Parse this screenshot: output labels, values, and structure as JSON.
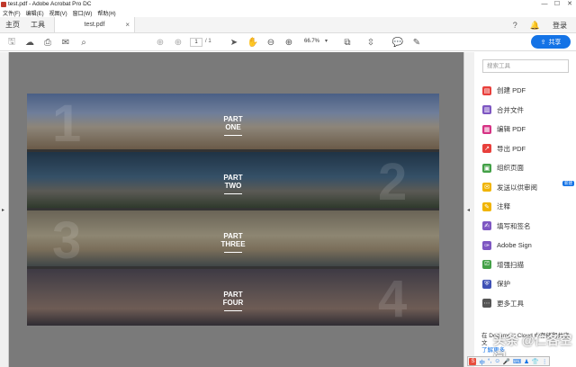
{
  "window": {
    "title": "test.pdf - Adobe Acrobat Pro DC",
    "min": "—",
    "max": "☐",
    "close": "✕"
  },
  "menu": [
    "文件(F)",
    "编辑(E)",
    "视图(V)",
    "窗口(W)",
    "帮助(H)"
  ],
  "tabs": {
    "home": "主页",
    "tools": "工具",
    "doc": "test.pdf"
  },
  "header_right": {
    "login": "登录"
  },
  "toolbar": {
    "page_current": "1",
    "page_total": "/ 1",
    "zoom": "66.7%",
    "share_label": "共享"
  },
  "document": {
    "parts": [
      {
        "label1": "PART",
        "label2": "ONE",
        "number": "1"
      },
      {
        "label1": "PART",
        "label2": "TWO",
        "number": "2"
      },
      {
        "label1": "PART",
        "label2": "THREE",
        "number": "3"
      },
      {
        "label1": "PART",
        "label2": "FOUR",
        "number": "4"
      }
    ]
  },
  "panel": {
    "search_placeholder": "搜索工具",
    "tools": [
      {
        "label": "创建 PDF",
        "icon": "create-pdf-icon",
        "color": "#e8403c"
      },
      {
        "label": "合并文件",
        "icon": "combine-files-icon",
        "color": "#7e57c2"
      },
      {
        "label": "编辑 PDF",
        "icon": "edit-pdf-icon",
        "color": "#d63384"
      },
      {
        "label": "导出 PDF",
        "icon": "export-pdf-icon",
        "color": "#e8403c"
      },
      {
        "label": "组织页面",
        "icon": "organize-pages-icon",
        "color": "#43a047"
      },
      {
        "label": "发送以供审阅",
        "icon": "send-review-icon",
        "color": "#f0b400",
        "badge": "新建"
      },
      {
        "label": "注释",
        "icon": "comment-icon",
        "color": "#f0b400"
      },
      {
        "label": "填写和签名",
        "icon": "fill-sign-icon",
        "color": "#7e57c2"
      },
      {
        "label": "Adobe Sign",
        "icon": "adobe-sign-icon",
        "color": "#7e57c2"
      },
      {
        "label": "增强扫描",
        "icon": "enhance-scan-icon",
        "color": "#43a047"
      },
      {
        "label": "保护",
        "icon": "protect-icon",
        "color": "#3f51b5"
      },
      {
        "label": "更多工具",
        "icon": "more-tools-icon",
        "color": "#555555"
      }
    ],
    "footer_text": "在 Document Cloud 中存储和共享文",
    "footer_sub": "了解更多"
  },
  "watermark": "头条 @仁各空间",
  "ime": [
    "S",
    "中",
    "°,",
    "☺",
    "🎤",
    "⌨",
    "♟",
    "👕",
    "⋮"
  ]
}
